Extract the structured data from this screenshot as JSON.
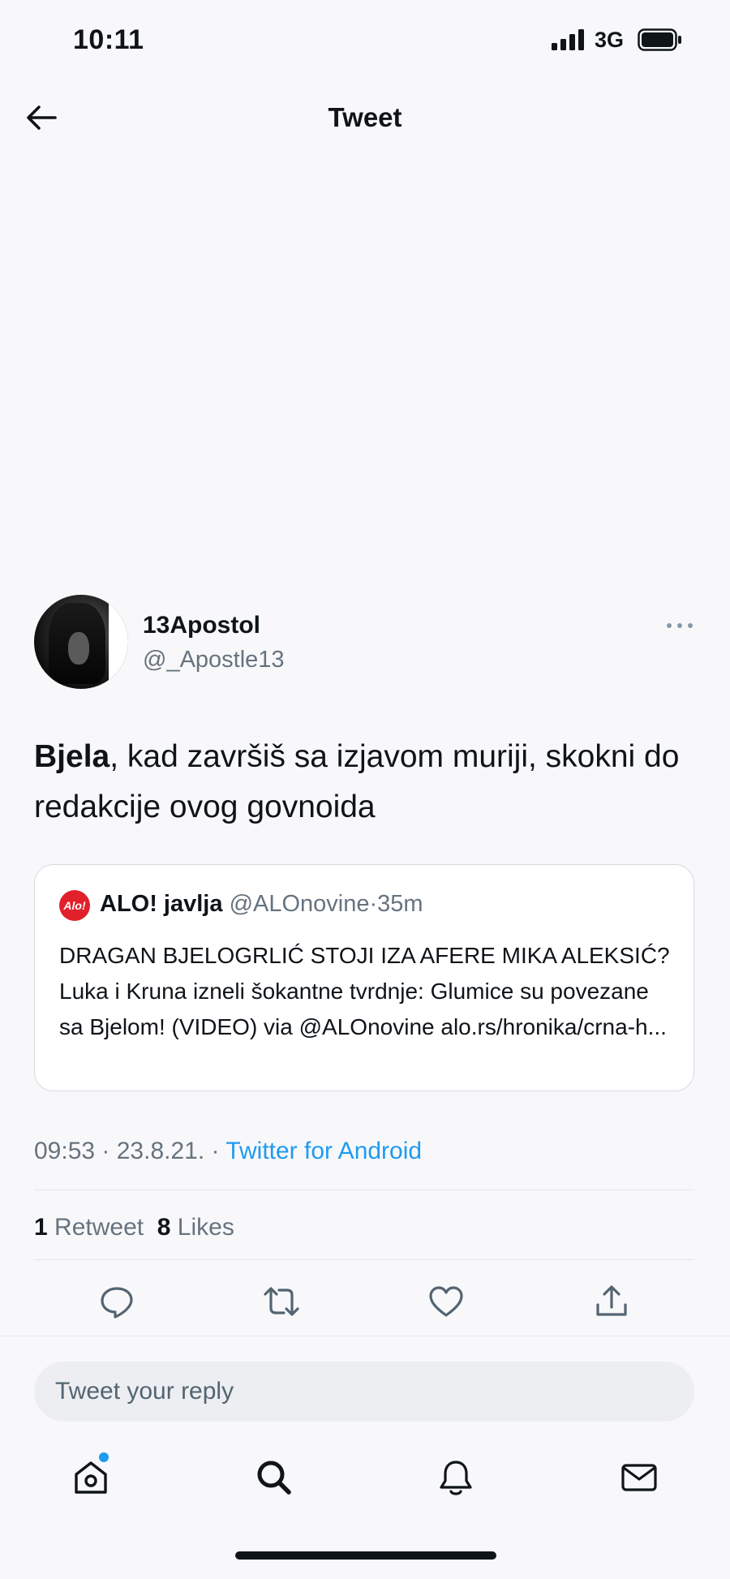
{
  "status_bar": {
    "time": "10:11",
    "network": "3G"
  },
  "nav": {
    "title": "Tweet",
    "back_icon": "arrow-left-icon"
  },
  "tweet": {
    "display_name": "13Apostol",
    "handle": "@_Apostle13",
    "text_bold": "Bjela",
    "text_rest": ", kad završiš sa izjavom muriji, skokni do redakcije ovog govnoida",
    "quote": {
      "logo_text": "Alo!",
      "name": "ALO! javlja",
      "handle": "@ALOnovine",
      "separator": "·",
      "age": "35m",
      "text": "DRAGAN BJELOGRLIĆ STOJI IZA AFERE MIKA ALEKSIĆ? Luka i Kruna izneli šokantne tvrdnje: Glumice su povezane sa Bjelom! (VIDEO) via @ALOnovine alo.rs/hronika/crna-h..."
    },
    "time": "09:53",
    "date": "23.8.21.",
    "source": "Twitter for Android",
    "meta_sep": " · ",
    "retweets": "1",
    "retweets_label": "Retweet",
    "likes": "8",
    "likes_label": "Likes"
  },
  "actions": [
    "reply-icon",
    "retweet-icon",
    "like-icon",
    "share-icon"
  ],
  "reply": {
    "placeholder": "Tweet your reply"
  },
  "tabbar": [
    "home-icon",
    "search-icon",
    "notifications-icon",
    "messages-icon"
  ],
  "colors": {
    "accent": "#1d9bf0",
    "text": "#0f1419",
    "muted": "#66737f",
    "background": "#f8f8fa"
  }
}
